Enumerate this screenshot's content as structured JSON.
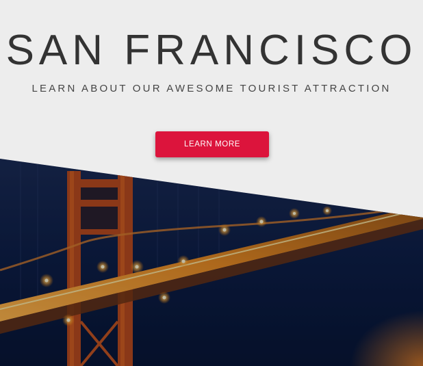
{
  "hero": {
    "title": "SAN FRANCISCO",
    "subtitle": "LEARN ABOUT OUR AWESOME TOURIST ATTRACTION",
    "cta_label": "LEARN MORE",
    "image_icon": "golden-gate-bridge-photo"
  },
  "colors": {
    "background": "#ededed",
    "title_text": "#333333",
    "accent": "#dc143c",
    "photo_sky": "#0b1a3d"
  }
}
